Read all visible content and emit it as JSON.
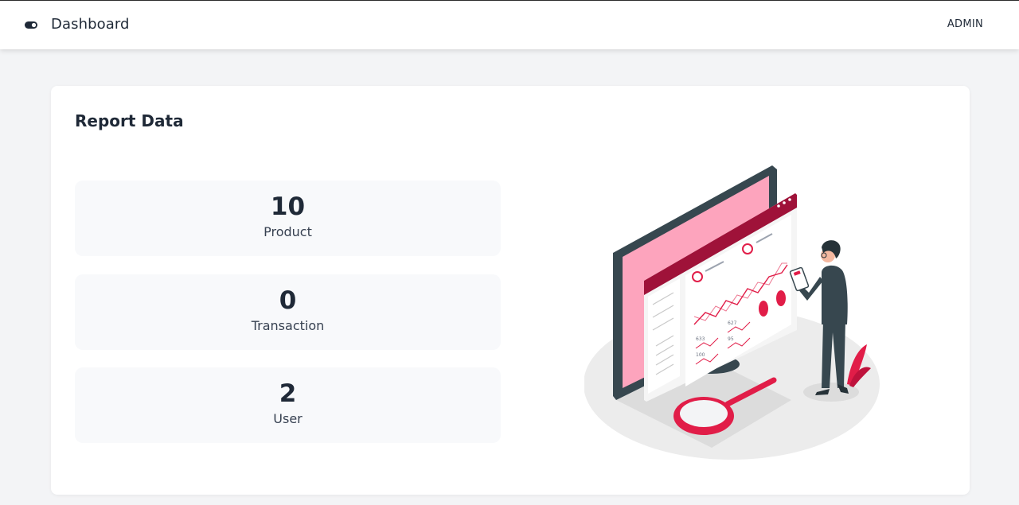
{
  "header": {
    "title": "Dashboard",
    "user_label": "ADMIN"
  },
  "report": {
    "title": "Report Data",
    "stats": [
      {
        "value": "10",
        "label": "Product"
      },
      {
        "value": "0",
        "label": "Transaction"
      },
      {
        "value": "2",
        "label": "User"
      }
    ]
  },
  "illustration": {
    "chart_labels": [
      "633",
      "627",
      "95",
      "100"
    ]
  },
  "colors": {
    "accent": "#e11d48",
    "accent_light": "#fda4bd",
    "dark": "#37474f",
    "background": "#f3f4f6"
  }
}
